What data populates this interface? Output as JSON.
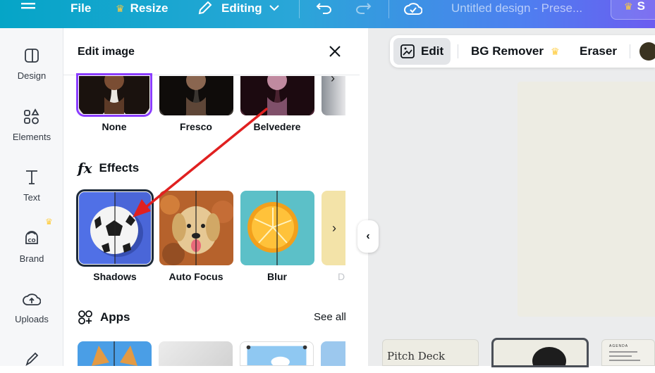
{
  "topbar": {
    "file": "File",
    "resize": "Resize",
    "editing": "Editing",
    "doc_title": "Untitled design - Prese...",
    "share_partial": "S"
  },
  "rail": {
    "items": [
      {
        "label": "Design",
        "icon": "layout-icon"
      },
      {
        "label": "Elements",
        "icon": "shapes-icon"
      },
      {
        "label": "Text",
        "icon": "text-icon"
      },
      {
        "label": "Brand",
        "icon": "brand-icon"
      },
      {
        "label": "Uploads",
        "icon": "upload-cloud-icon"
      }
    ]
  },
  "panel": {
    "title": "Edit image",
    "filters": [
      {
        "label": "None"
      },
      {
        "label": "Fresco"
      },
      {
        "label": "Belvedere"
      }
    ],
    "effects_heading": "Effects",
    "effects_icon_text": "fx",
    "effects": [
      {
        "label": "Shadows"
      },
      {
        "label": "Auto Focus"
      },
      {
        "label": "Blur"
      },
      {
        "label": "D"
      }
    ],
    "apps_heading": "Apps",
    "see_all": "See all"
  },
  "toolbar": {
    "edit": "Edit",
    "bg_remover": "BG Remover",
    "eraser": "Eraser"
  },
  "strip": {
    "first_label": "Pitch Deck",
    "third_label": "AGENDA"
  },
  "colors": {
    "accent_purple": "#8b3dff",
    "crown": "#ffcc3d",
    "arrow": "#e02020"
  }
}
